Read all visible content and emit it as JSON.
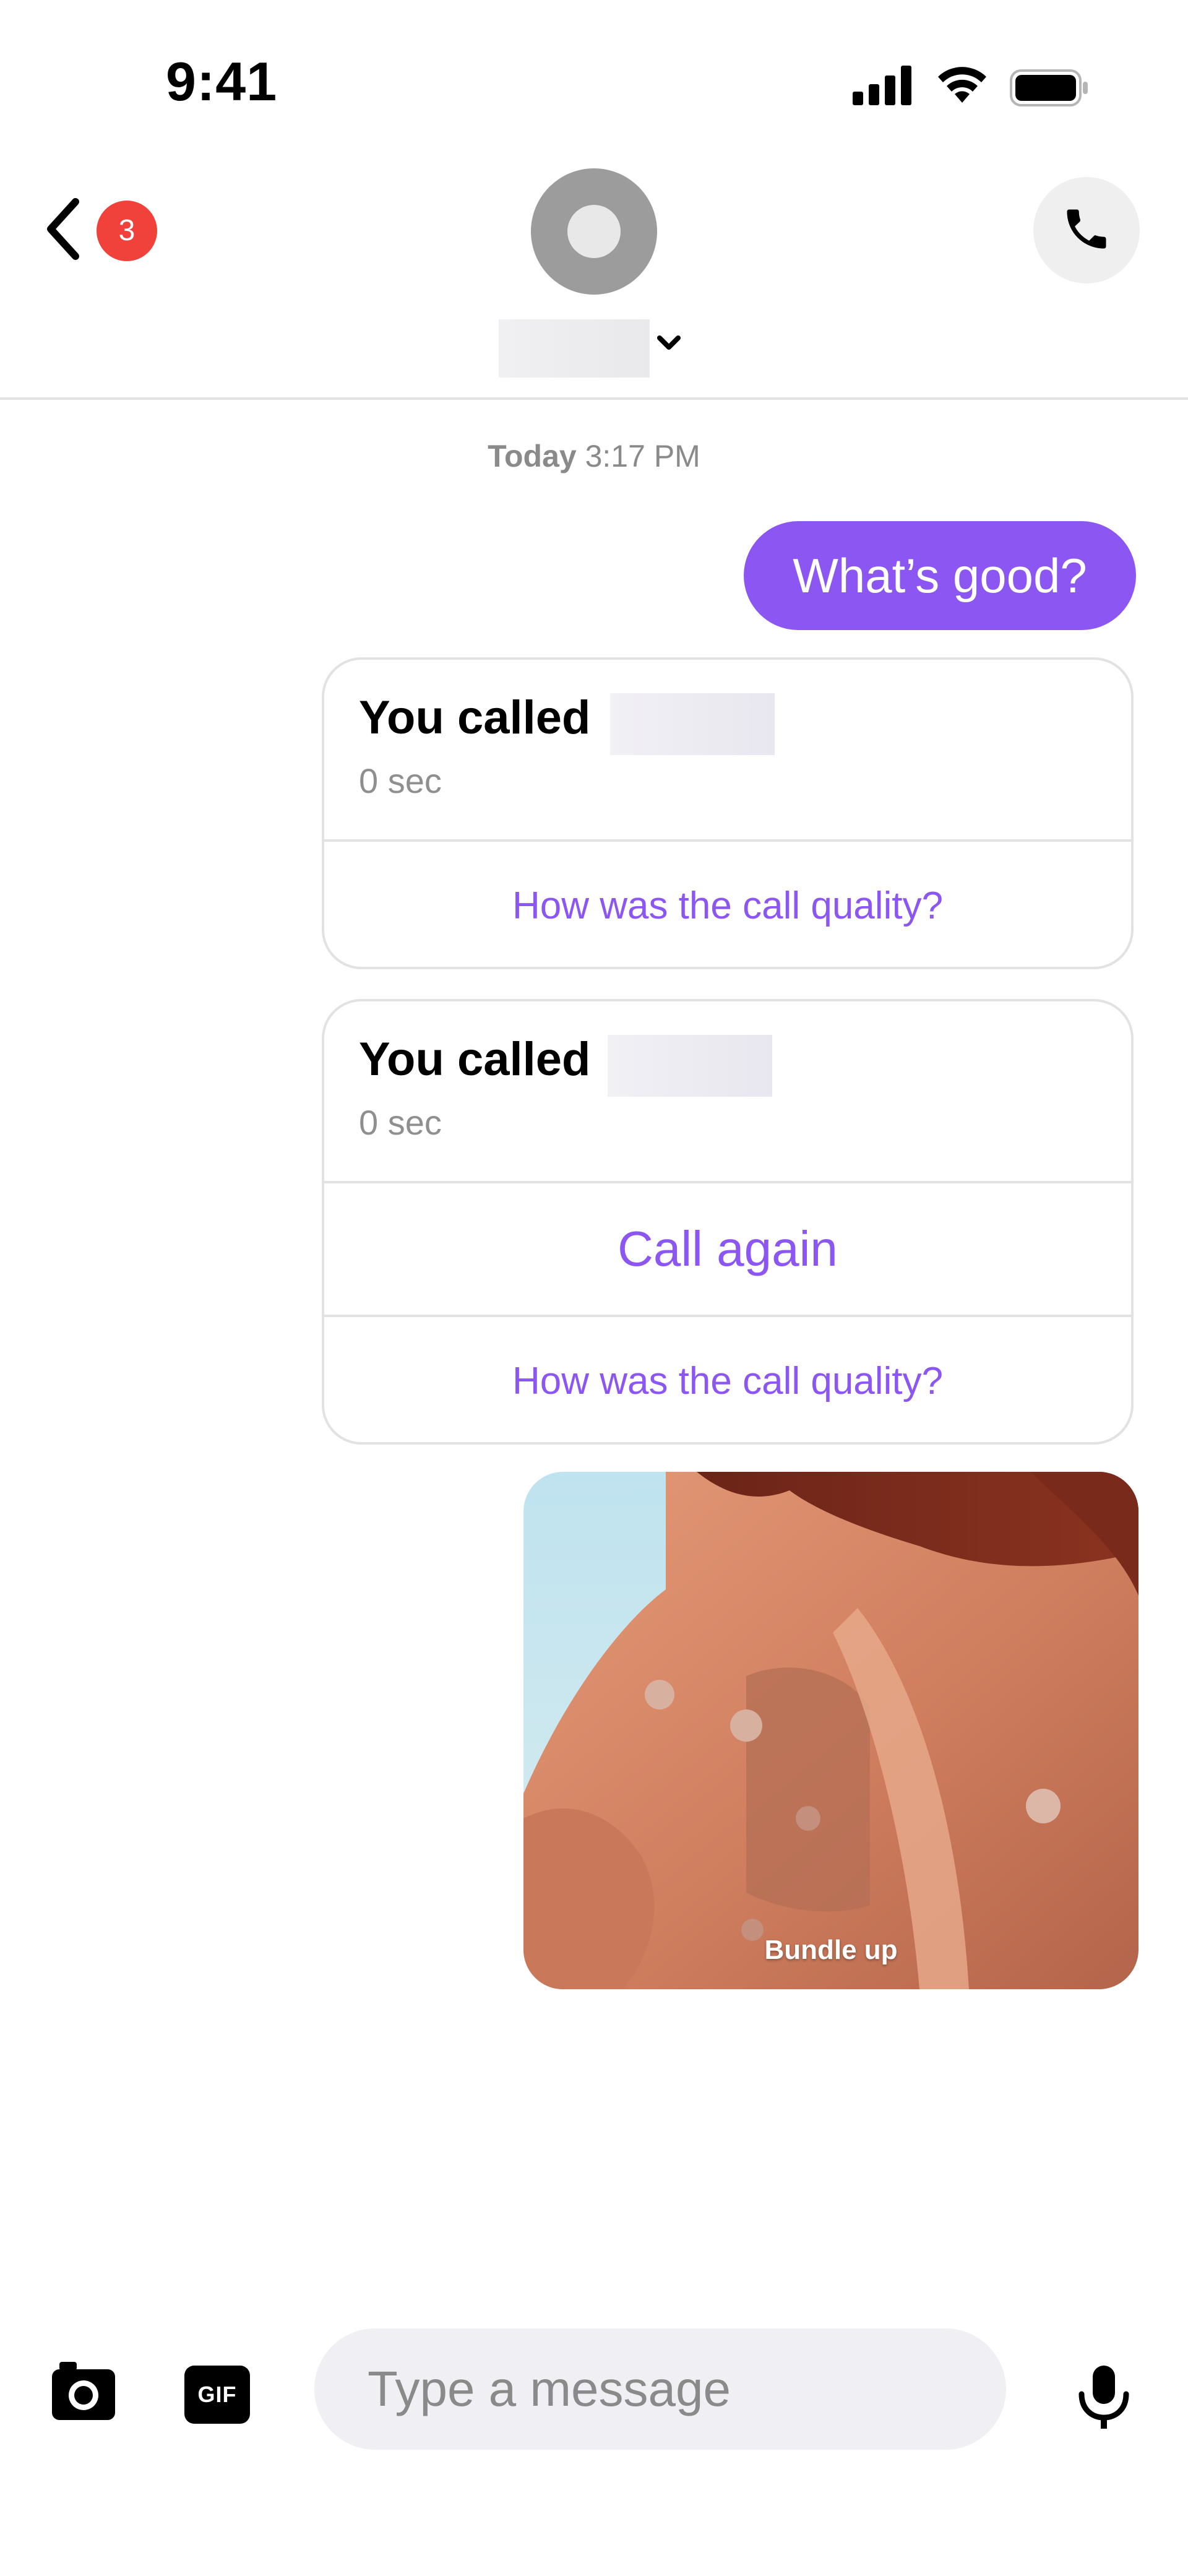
{
  "status_bar": {
    "time": "9:41",
    "signal_icon": "cellular-signal-icon",
    "wifi_icon": "wifi-icon",
    "battery_icon": "battery-icon"
  },
  "header": {
    "back_icon": "chevron-left-icon",
    "unread_badge": "3",
    "avatar_icon": "avatar-placeholder-icon",
    "name_dropdown_icon": "chevron-down-icon",
    "call_icon": "phone-icon"
  },
  "conversation": {
    "timestamp_day": "Today",
    "timestamp_time": "3:17 PM",
    "sent_message": "What’s good?",
    "call_cards": [
      {
        "title": "You called",
        "duration": "0 sec",
        "quality_link": "How was the call quality?"
      },
      {
        "title": "You called",
        "duration": "0 sec",
        "call_again": "Call again",
        "quality_link": "How was the call quality?"
      }
    ],
    "gif_caption": "Bundle up"
  },
  "composer": {
    "camera_icon": "camera-icon",
    "gif_label": "GIF",
    "placeholder": "Type a message",
    "mic_icon": "microphone-icon"
  },
  "colors": {
    "accent": "#8b56f2",
    "badge": "#f0413a",
    "divider": "#e2e2e2",
    "input_bg": "#f0f0f4"
  }
}
